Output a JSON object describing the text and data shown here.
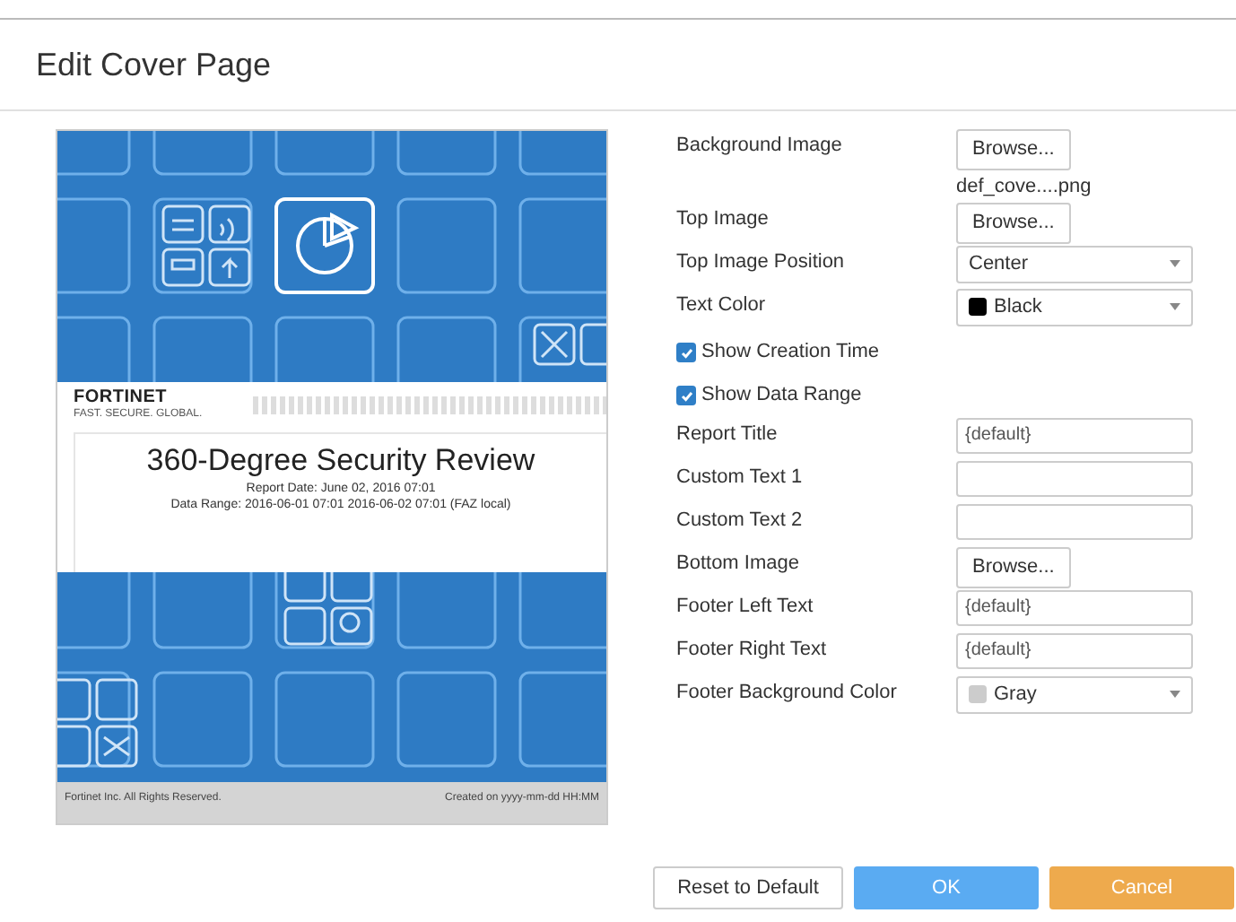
{
  "dialog": {
    "title": "Edit Cover Page"
  },
  "preview": {
    "logo": "FORTINET",
    "tagline": "FAST. SECURE. GLOBAL.",
    "title": "360-Degree Security Review",
    "report_date": "Report Date: June 02, 2016 07:01",
    "data_range": "Data Range: 2016-06-01 07:01 2016-06-02 07:01 (FAZ local)",
    "footer_left": "Fortinet Inc. All Rights Reserved.",
    "footer_right": "Created on yyyy-mm-dd HH:MM"
  },
  "fields": [
    {
      "kind": "file",
      "label": "Background Image",
      "button": "Browse...",
      "filename": "def_cove....png"
    },
    {
      "kind": "file",
      "label": "Top Image",
      "button": "Browse..."
    },
    {
      "kind": "select",
      "label": "Top Image Position",
      "value": "Center"
    },
    {
      "kind": "select",
      "label": "Text Color",
      "value": "Black",
      "color": "#000000"
    },
    {
      "kind": "checkbox",
      "label": "Show Creation Time",
      "checked": true
    },
    {
      "kind": "checkbox",
      "label": "Show Data Range",
      "checked": true
    },
    {
      "kind": "text",
      "label": "Report Title",
      "value": "{default}"
    },
    {
      "kind": "text",
      "label": "Custom Text 1"
    },
    {
      "kind": "text",
      "label": "Custom Text 2"
    },
    {
      "kind": "file",
      "label": "Bottom Image",
      "button": "Browse..."
    },
    {
      "kind": "text",
      "label": "Footer Left Text",
      "value": "{default}"
    },
    {
      "kind": "text",
      "label": "Footer Right Text",
      "value": "{default}"
    },
    {
      "kind": "select",
      "label": "Footer Background Color",
      "value": "Gray",
      "color": "#cccccc"
    }
  ],
  "buttons": [
    {
      "label": "Reset to Default",
      "kind": "default"
    },
    {
      "label": "OK",
      "kind": "primary"
    },
    {
      "label": "Cancel",
      "kind": "cancel"
    }
  ]
}
